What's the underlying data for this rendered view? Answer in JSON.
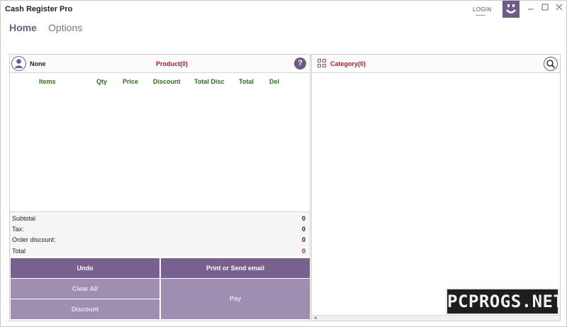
{
  "app": {
    "title": "Cash Register Pro",
    "login_label": "LOGIN"
  },
  "nav": {
    "tabs": [
      {
        "label": "Home"
      },
      {
        "label": "Options"
      }
    ]
  },
  "order": {
    "customer": "None",
    "product_title": "Product(0)",
    "columns": [
      "Items",
      "Qty",
      "Price",
      "Discount",
      "Total Disc",
      "Total",
      "Del"
    ],
    "summary": [
      {
        "label": "Subtotal",
        "value": "0"
      },
      {
        "label": "Tax:",
        "value": "0"
      },
      {
        "label": "Order discount:",
        "value": "0"
      },
      {
        "label": "Total",
        "value": "0"
      }
    ]
  },
  "actions": {
    "undo": "Undo",
    "print_email": "Print or Send email",
    "clear_all": "Clear All",
    "discount": "Discount",
    "pay": "Pay"
  },
  "category": {
    "title": "Category(0)"
  },
  "watermark": "PCPROGS.NET",
  "colors": {
    "accent": "#6f5a88",
    "button_dark": "#78608f",
    "button_light": "#9e8eb1",
    "header_green": "#2f6d1e",
    "title_red": "#a31f24"
  },
  "icons": [
    "smiley-icon",
    "customer-icon",
    "help-icon",
    "category-grid-icon",
    "search-icon"
  ]
}
